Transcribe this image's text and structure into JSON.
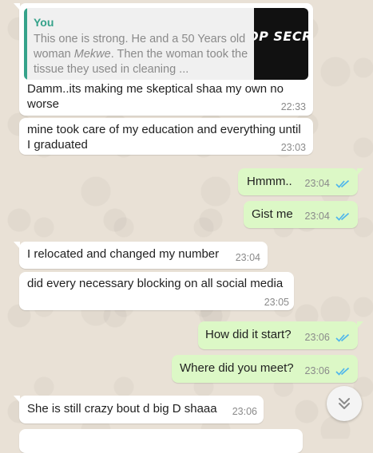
{
  "colors": {
    "incoming_bubble": "#ffffff",
    "outgoing_bubble": "#dcf8c6",
    "read_ticks": "#4fb6ec",
    "reply_accent": "#35a28a",
    "timestamp": "#8a8a8a"
  },
  "quoted_reply": {
    "sender": "You",
    "text_before_italic": "This one is strong. He and a 50 Years old woman ",
    "text_italic": "Mekwe",
    "text_after_italic": ". Then the woman took the tissue they used in cleaning ...",
    "thumbnail_text": "OP SECRE"
  },
  "messages": [
    {
      "direction": "in",
      "text": "Damm..its making me skeptical shaa my own no worse",
      "time": "22:33"
    },
    {
      "direction": "in",
      "text": "mine took care of my education and everything until I graduated",
      "time": "23:03"
    },
    {
      "direction": "out",
      "text": "Hmmm..",
      "time": "23:04",
      "status": "read"
    },
    {
      "direction": "out",
      "text": "Gist me",
      "time": "23:04",
      "status": "read"
    },
    {
      "direction": "in",
      "text": "I relocated and changed my number",
      "time": "23:04"
    },
    {
      "direction": "in",
      "text": "did every necessary blocking on all social media",
      "time": "23:05"
    },
    {
      "direction": "out",
      "text": "How did it start?",
      "time": "23:06",
      "status": "read"
    },
    {
      "direction": "out",
      "text": "Where did you meet?",
      "time": "23:06",
      "status": "read"
    },
    {
      "direction": "in",
      "text": "She is still crazy bout d big D shaaa",
      "time": "23:06"
    }
  ],
  "scroll_button_icon": "double-chevron-down-icon"
}
